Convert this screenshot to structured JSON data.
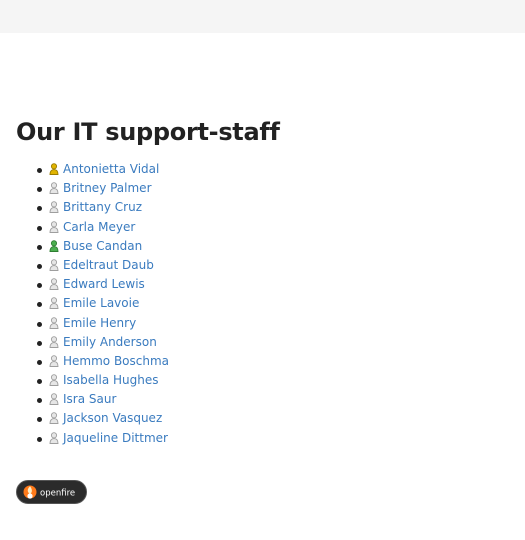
{
  "page": {
    "heading": "Our IT support-staff"
  },
  "colors": {
    "link": "#3a7bbf",
    "status_available": "#4caf50",
    "status_away": "#e0b400",
    "status_offline": "#bdbdbd"
  },
  "staff": [
    {
      "name": "Antonietta Vidal",
      "status": "away"
    },
    {
      "name": "Britney Palmer",
      "status": "offline"
    },
    {
      "name": "Brittany Cruz",
      "status": "offline"
    },
    {
      "name": "Carla Meyer",
      "status": "offline"
    },
    {
      "name": "Buse Candan",
      "status": "available"
    },
    {
      "name": "Edeltraut Daub",
      "status": "offline"
    },
    {
      "name": "Edward Lewis",
      "status": "offline"
    },
    {
      "name": "Emile Lavoie",
      "status": "offline"
    },
    {
      "name": "Emile Henry",
      "status": "offline"
    },
    {
      "name": "Emily Anderson",
      "status": "offline"
    },
    {
      "name": "Hemmo Boschma",
      "status": "offline"
    },
    {
      "name": "Isabella Hughes",
      "status": "offline"
    },
    {
      "name": "Isra Saur",
      "status": "offline"
    },
    {
      "name": "Jackson Vasquez",
      "status": "offline"
    },
    {
      "name": "Jaqueline Dittmer",
      "status": "offline"
    }
  ],
  "footer": {
    "logo_text": "openfire",
    "logo_icon": "openfire-flame-icon"
  }
}
